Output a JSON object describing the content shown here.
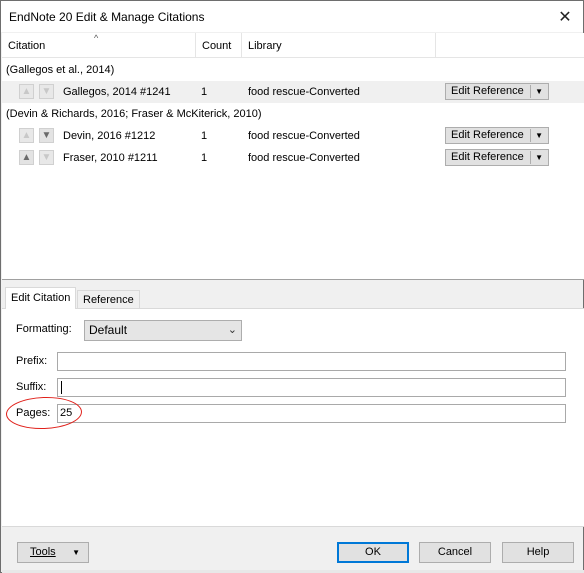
{
  "window": {
    "title": "EndNote 20 Edit & Manage Citations",
    "close_glyph": "✕"
  },
  "list": {
    "columns": [
      "Citation",
      "Count",
      "Library"
    ],
    "groups": [
      {
        "label": "(Gallegos et al., 2014)",
        "rows": [
          {
            "citation": "Gallegos, 2014 #1241",
            "count": "1",
            "library": "food rescue-Converted",
            "action": "Edit Reference",
            "up_enabled": false,
            "down_enabled": false,
            "selected": true
          }
        ]
      },
      {
        "label": "(Devin & Richards, 2016; Fraser & McKiterick, 2010)",
        "rows": [
          {
            "citation": "Devin, 2016 #1212",
            "count": "1",
            "library": "food rescue-Converted",
            "action": "Edit Reference",
            "up_enabled": false,
            "down_enabled": true,
            "selected": false
          },
          {
            "citation": "Fraser, 2010 #1211",
            "count": "1",
            "library": "food rescue-Converted",
            "action": "Edit Reference",
            "up_enabled": true,
            "down_enabled": false,
            "selected": false
          }
        ]
      }
    ]
  },
  "tabs": [
    {
      "label": "Edit Citation",
      "active": true
    },
    {
      "label": "Reference",
      "active": false
    }
  ],
  "form": {
    "formatting_label": "Formatting:",
    "formatting_value": "Default",
    "prefix_label": "Prefix:",
    "prefix_value": "",
    "suffix_label": "Suffix:",
    "suffix_value": "",
    "pages_label": "Pages:",
    "pages_value": "25"
  },
  "buttons": {
    "tools": "Tools",
    "ok": "OK",
    "cancel": "Cancel",
    "help": "Help"
  },
  "annotation": {
    "color": "#e0201a"
  }
}
